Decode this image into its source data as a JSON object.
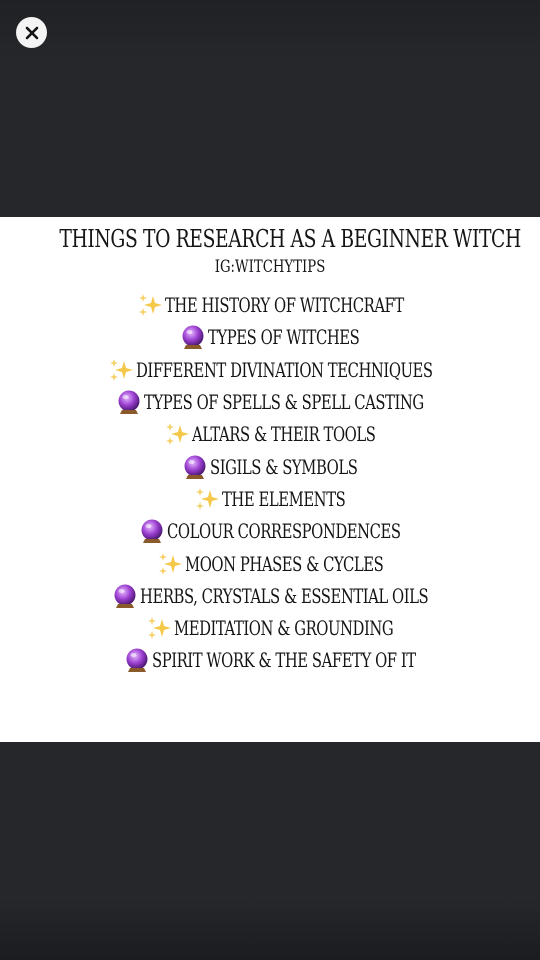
{
  "viewer": {
    "close_icon": "close-icon",
    "colors": {
      "backdrop": "#25272b",
      "close_button": "#f4f4f4",
      "image_background": "#ffffff",
      "text": "#151515",
      "sparkle": "#f5c84a",
      "crystal_ball": "#9b3fd0"
    }
  },
  "image": {
    "title": "THINGS TO RESEARCH AS A BEGINNER WITCH",
    "handle": "IG:WITCHYTIPS",
    "topics": [
      {
        "icon": "sparkles-icon",
        "text": "THE HISTORY OF WITCHCRAFT"
      },
      {
        "icon": "crystal-ball-icon",
        "text": "TYPES OF WITCHES"
      },
      {
        "icon": "sparkles-icon",
        "text": "DIFFERENT DIVINATION TECHNIQUES"
      },
      {
        "icon": "crystal-ball-icon",
        "text": "TYPES OF SPELLS & SPELL CASTING"
      },
      {
        "icon": "sparkles-icon",
        "text": "ALTARS & THEIR TOOLS"
      },
      {
        "icon": "crystal-ball-icon",
        "text": "SIGILS & SYMBOLS"
      },
      {
        "icon": "sparkles-icon",
        "text": "THE ELEMENTS"
      },
      {
        "icon": "crystal-ball-icon",
        "text": "COLOUR CORRESPONDENCES"
      },
      {
        "icon": "sparkles-icon",
        "text": "MOON PHASES & CYCLES"
      },
      {
        "icon": "crystal-ball-icon",
        "text": "HERBS, CRYSTALS & ESSENTIAL OILS"
      },
      {
        "icon": "sparkles-icon",
        "text": "MEDITATION & GROUNDING"
      },
      {
        "icon": "crystal-ball-icon",
        "text": "SPIRIT WORK & THE SAFETY OF IT"
      }
    ]
  }
}
